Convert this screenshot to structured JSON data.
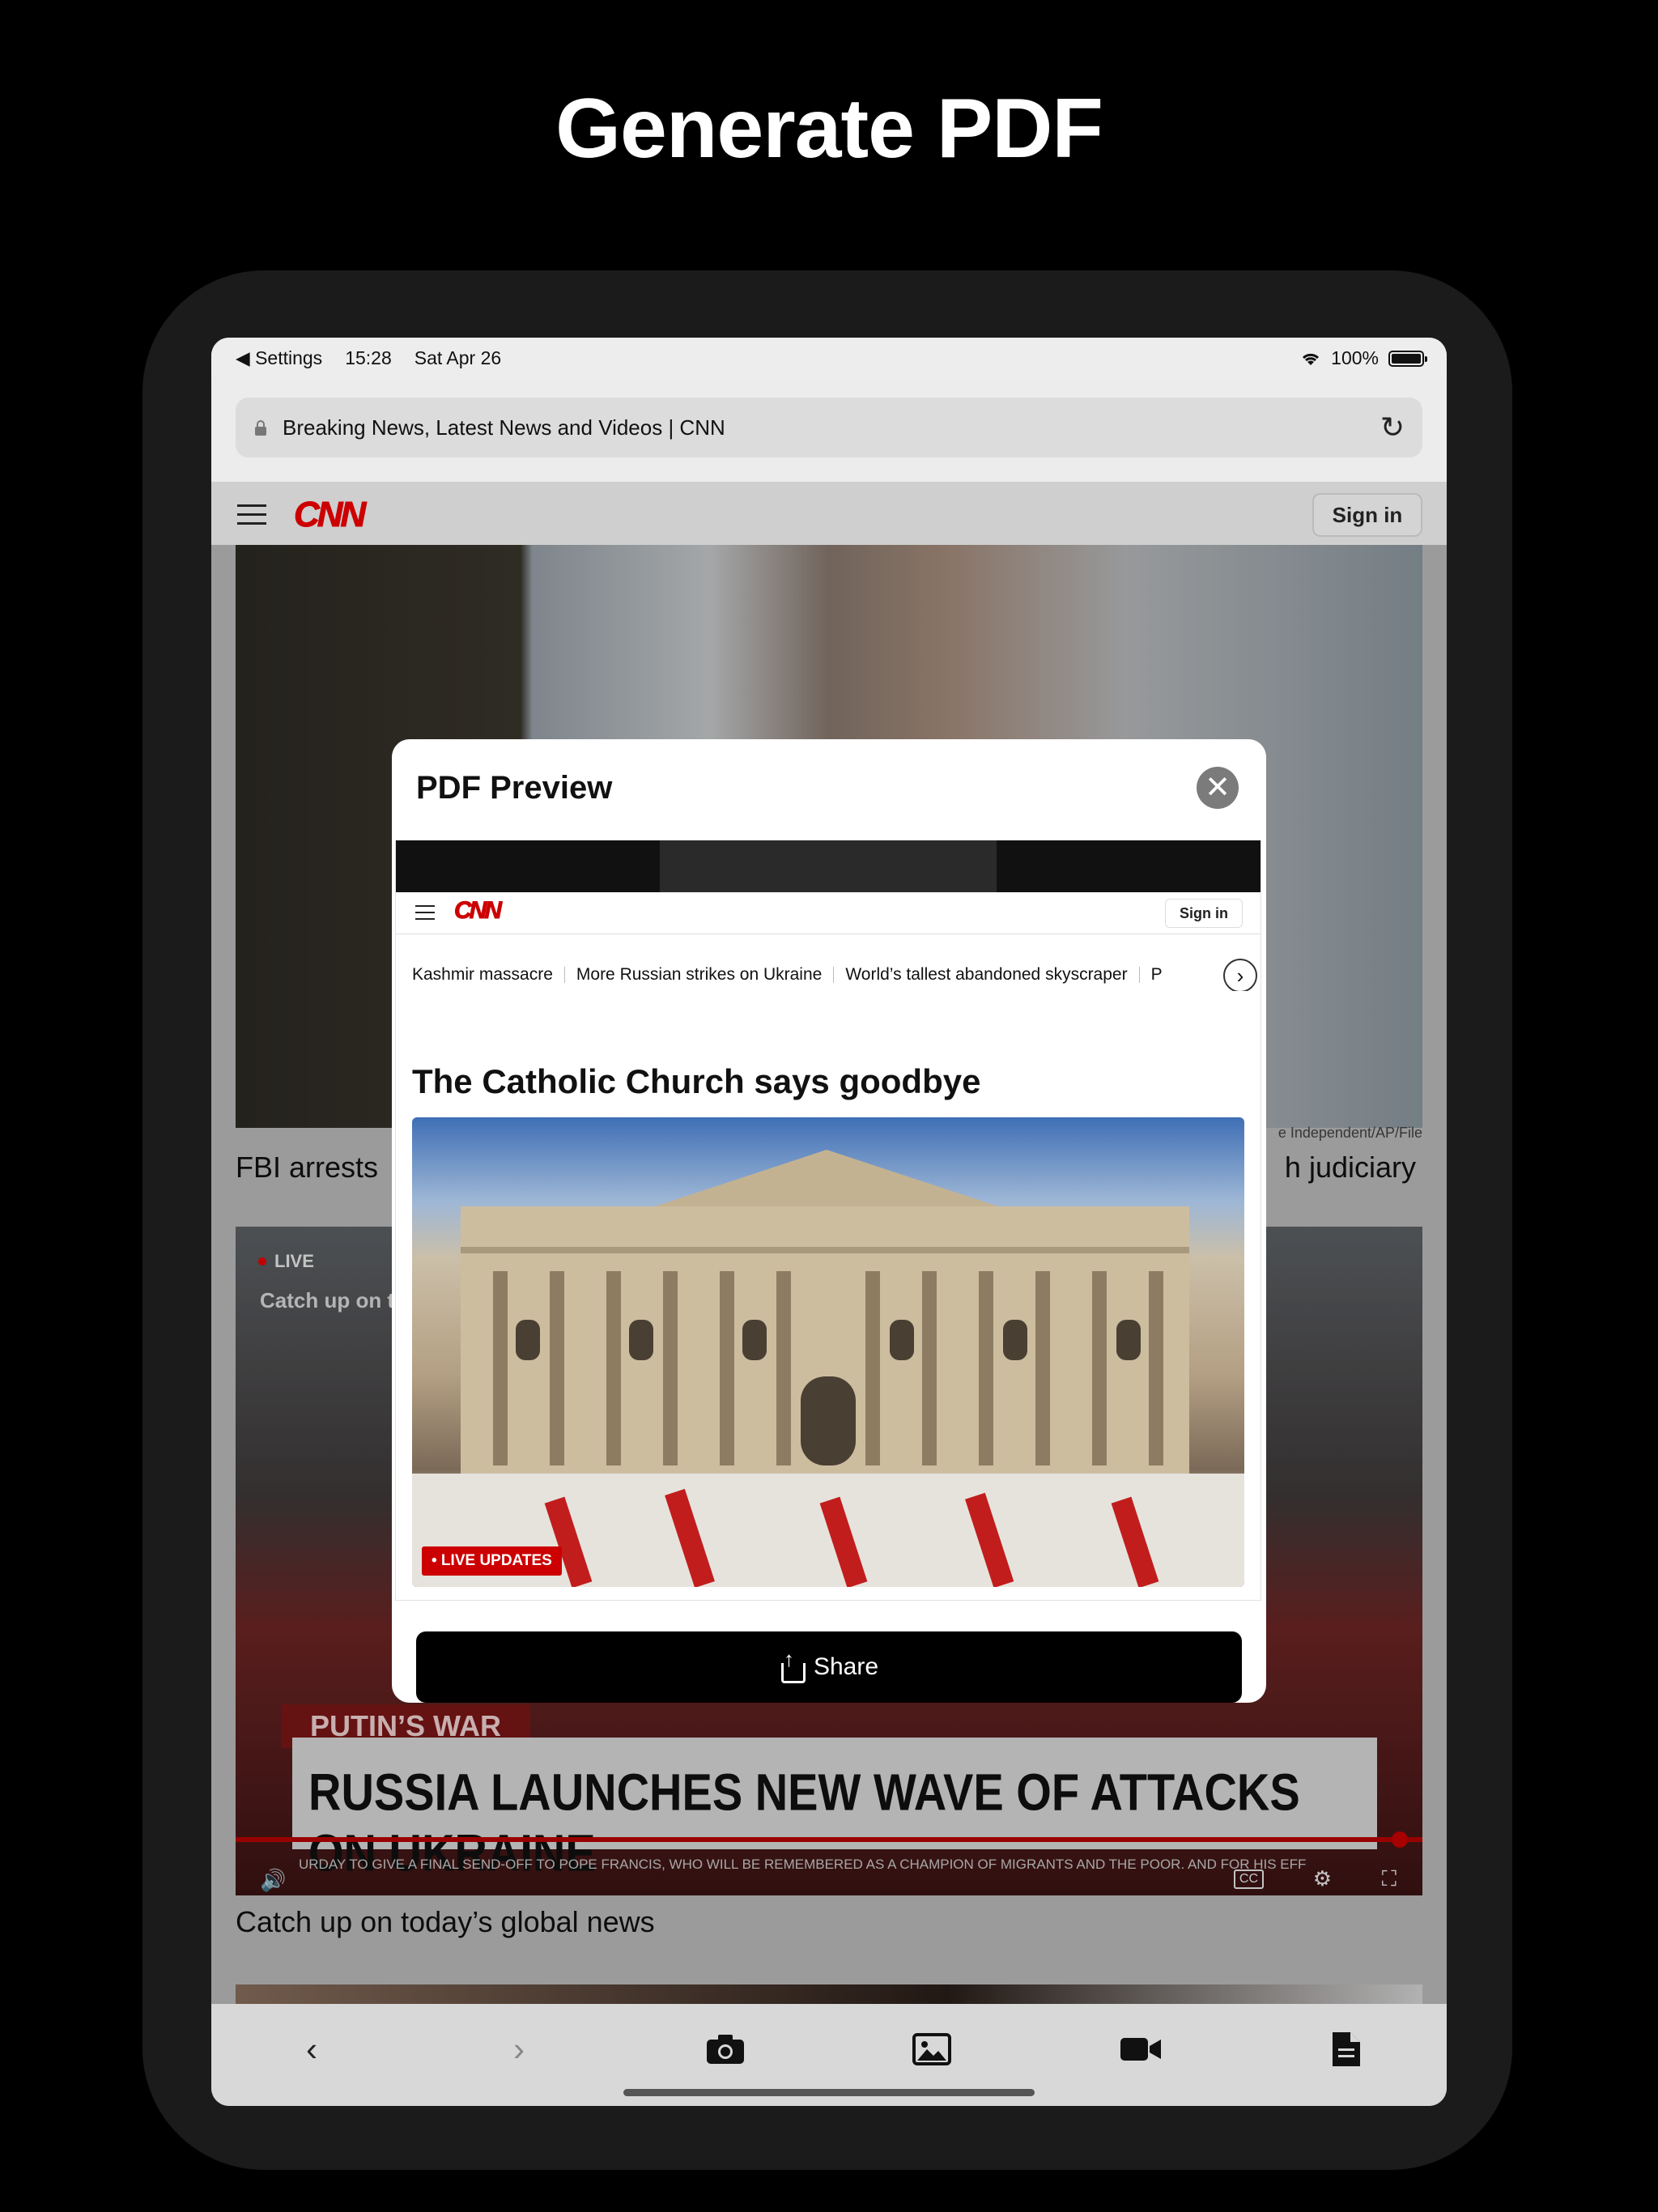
{
  "headline": "Generate PDF",
  "status_bar": {
    "back_app": "◀ Settings",
    "time": "15:28",
    "date": "Sat Apr 26",
    "battery": "100%"
  },
  "address_bar": {
    "title": "Breaking News, Latest News and Videos | CNN"
  },
  "site_header": {
    "logo": "CNN",
    "sign_in": "Sign in"
  },
  "background_content": {
    "photo_credit": "e Independent/AP/File",
    "story1_left": "FBI arrests",
    "story1_right": "h judiciary",
    "video": {
      "live_label": "LIVE",
      "catch_overlay": "Catch up on t",
      "kicker": "PUTIN’S WAR",
      "lower_third": "RUSSIA LAUNCHES NEW WAVE OF ATTACKS ON UKRAINE",
      "ticker": "URDAY TO GIVE A FINAL SEND-OFF TO POPE FRANCIS, WHO WILL BE REMEMBERED AS A CHAMPION OF MIGRANTS AND THE POOR. AND FOR HIS EFF",
      "cc": "CC"
    },
    "story2": "Catch up on today’s global news"
  },
  "modal": {
    "title": "PDF Preview",
    "close": "✕",
    "preview": {
      "logo": "CNN",
      "sign_in": "Sign in",
      "topics": [
        "Kashmir massacre",
        "More Russian strikes on Ukraine",
        "World’s tallest abandoned skyscraper",
        "P"
      ],
      "article_heading": "The Catholic Church says goodbye",
      "badge": "• LIVE UPDATES"
    },
    "share_label": "Share"
  },
  "toolbar": {
    "icons": [
      "back-icon",
      "forward-icon",
      "camera-icon",
      "photo-icon",
      "video-icon",
      "document-icon"
    ]
  }
}
